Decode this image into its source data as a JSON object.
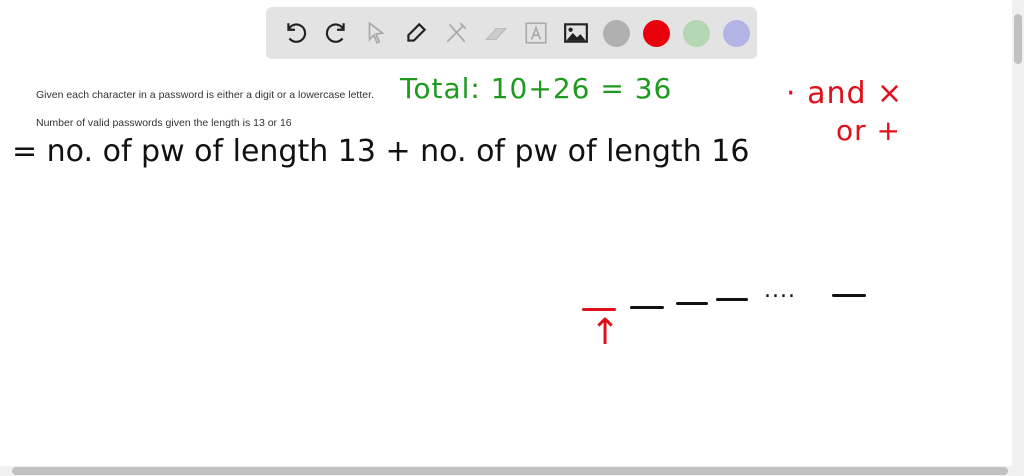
{
  "toolbar": {
    "tools": [
      "undo-icon",
      "redo-icon",
      "pointer-icon",
      "pen-icon",
      "tools-icon",
      "eraser-icon",
      "text-icon",
      "image-icon"
    ],
    "colors": [
      "#b0b0b0",
      "#e8000b",
      "#b5d6b2",
      "#b3b3e6"
    ]
  },
  "prompt": {
    "line1": "Given each character in a password is either a digit or a lowercase letter.",
    "line2": "Number of valid passwords given the length is 13 or 16"
  },
  "handwriting": {
    "total": "Total: 10+26 = 36",
    "and_x": "· and ×",
    "or_plus": "or +",
    "equation": "= no. of pw of length 13 + no. of pw of length 16",
    "dots": "....",
    "arrow": "↑"
  },
  "ink_colors": {
    "black": "#111111",
    "green": "#1e9a1e",
    "red": "#e0101a"
  }
}
